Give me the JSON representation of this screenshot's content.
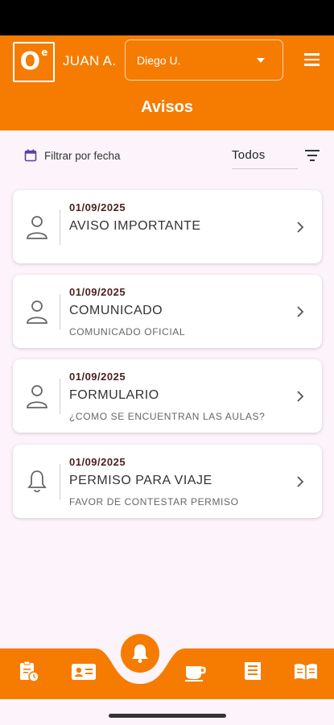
{
  "header": {
    "logo_main": "O",
    "logo_sup": "e",
    "username": "JUAN A.",
    "selector_value": "Diego U.",
    "title": "Avisos"
  },
  "filter": {
    "date_label": "Filtrar por fecha",
    "type_value": "Todos"
  },
  "notices": [
    {
      "date": "01/09/2025",
      "title": "AVISO IMPORTANTE",
      "subtitle": "",
      "icon": "person-icon"
    },
    {
      "date": "01/09/2025",
      "title": "COMUNICADO",
      "subtitle": "COMUNICADO OFICIAL",
      "icon": "person-icon"
    },
    {
      "date": "01/09/2025",
      "title": "FORMULARIO",
      "subtitle": "¿COMO SE ENCUENTRAN LAS AULAS?",
      "icon": "person-icon"
    },
    {
      "date": "01/09/2025",
      "title": "PERMISO PARA VIAJE",
      "subtitle": "FAVOR DE CONTESTAR PERMISO",
      "icon": "bell-icon"
    }
  ],
  "bottom_nav": {
    "items": [
      "clipboard-clock-icon",
      "contact-card-icon",
      "bell-icon",
      "coffee-cup-icon",
      "newspaper-icon",
      "book-icon"
    ],
    "active": "bell-icon"
  },
  "colors": {
    "primary": "#f57c00",
    "background": "#fcf4fa",
    "date_text": "#4a1f1f",
    "calendar_icon": "#5b3fa0"
  }
}
